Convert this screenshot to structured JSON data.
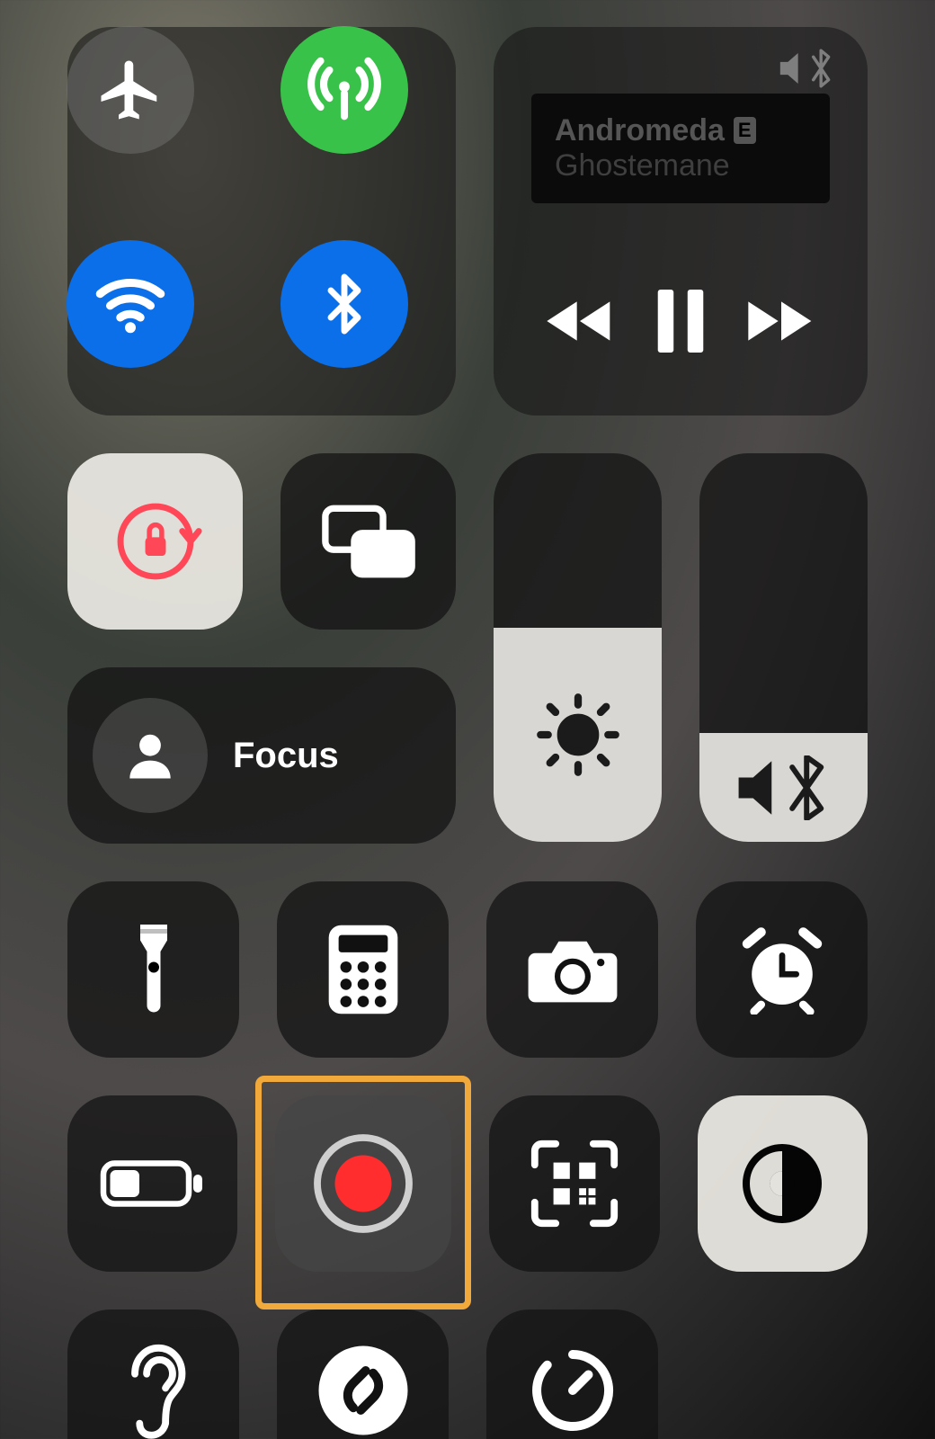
{
  "connectivity": {
    "airplane_mode": false,
    "cellular_on": true,
    "wifi_on": true,
    "bluetooth_on": true,
    "colors": {
      "active_green": "#39c24a",
      "active_blue": "#0a6fe8",
      "inactive": "rgba(120,120,120,0.45)"
    }
  },
  "media": {
    "title": "Andromeda",
    "artist": "Ghostemane",
    "explicit_badge": "E",
    "output_indicator": "bluetooth-speaker"
  },
  "orientation_lock": {
    "active": true
  },
  "screen_mirroring": {
    "label": "Screen Mirroring"
  },
  "focus": {
    "label": "Focus"
  },
  "sliders": {
    "brightness_percent": 55,
    "volume_percent": 28
  },
  "shortcut_tiles": [
    {
      "name": "flashlight"
    },
    {
      "name": "calculator"
    },
    {
      "name": "camera"
    },
    {
      "name": "alarm"
    },
    {
      "name": "low-power-mode"
    },
    {
      "name": "screen-record",
      "highlighted": true
    },
    {
      "name": "qr-code-scanner"
    },
    {
      "name": "dark-mode",
      "light_tile": true
    },
    {
      "name": "hearing"
    },
    {
      "name": "shazam"
    },
    {
      "name": "timer"
    }
  ],
  "highlight_color": "#f0a93a"
}
